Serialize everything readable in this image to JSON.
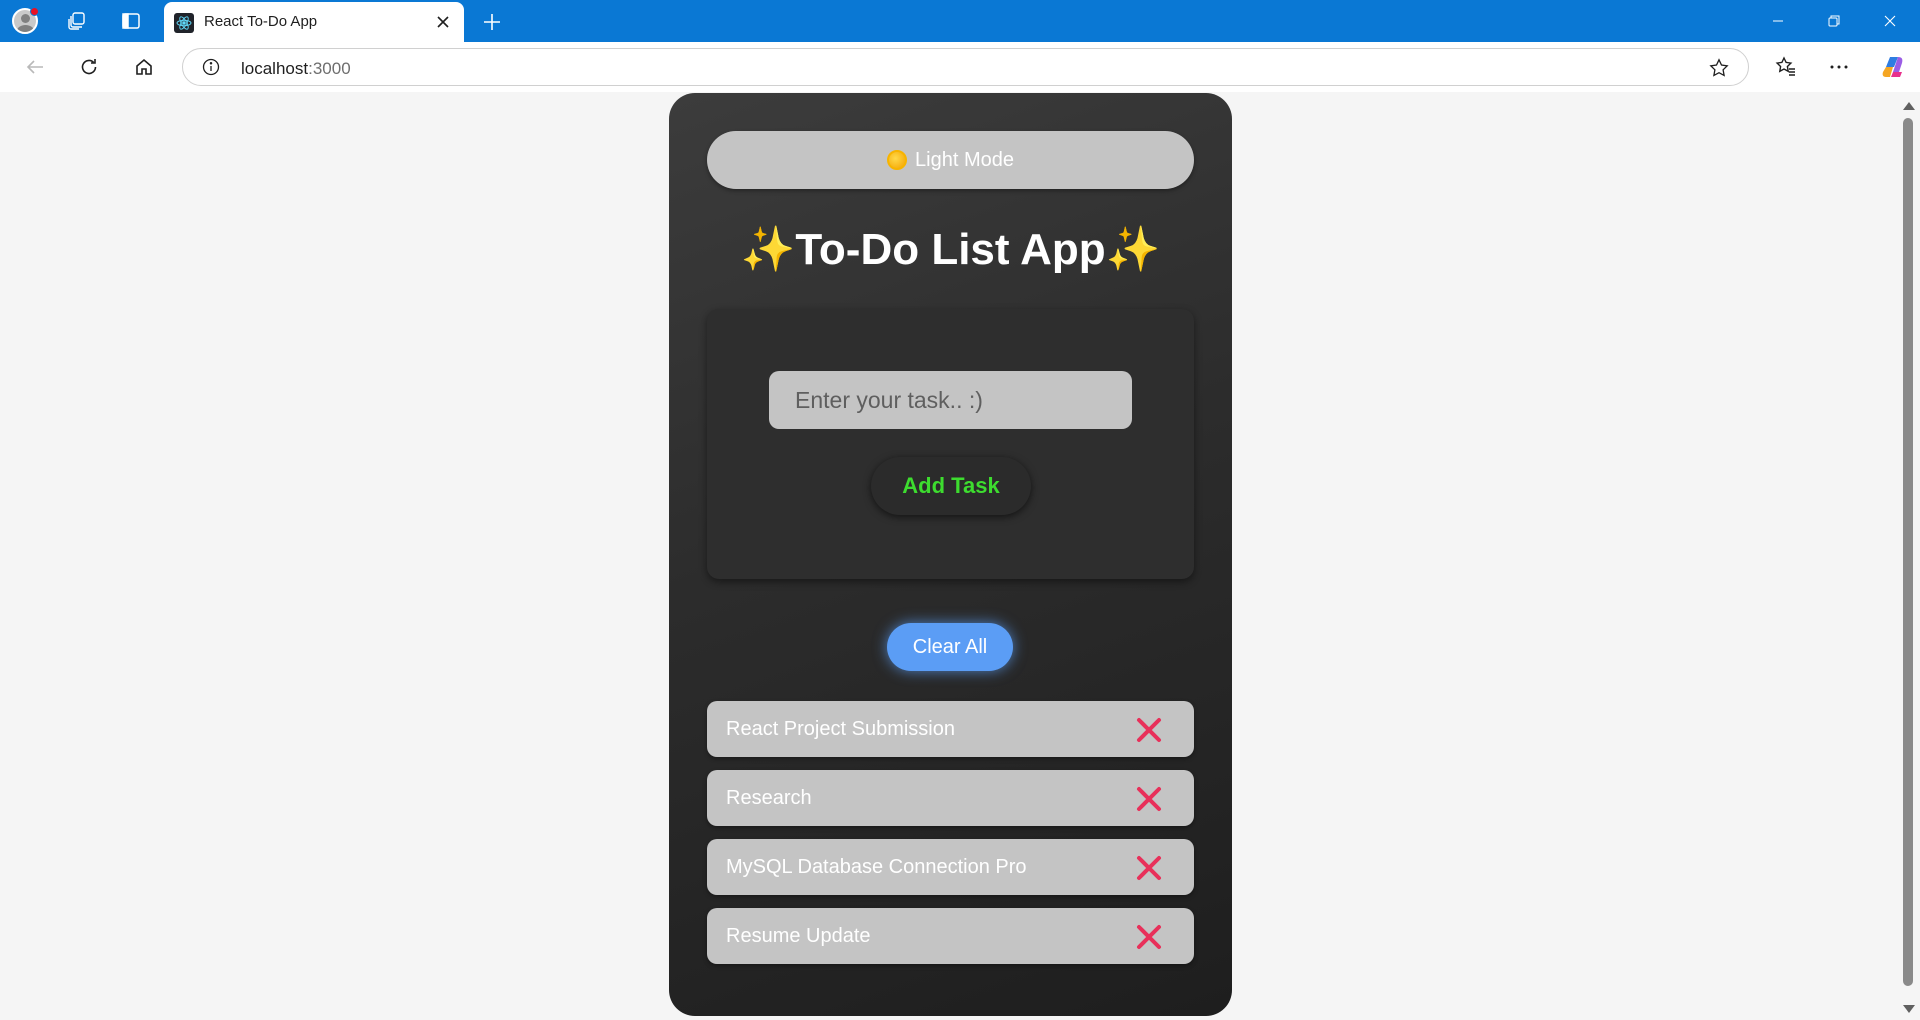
{
  "browser": {
    "tab": {
      "title": "React To-Do App"
    },
    "address": {
      "host": "localhost",
      "port": ":3000"
    }
  },
  "app": {
    "mode_toggle": {
      "label": "Light Mode",
      "icon": "sun-icon"
    },
    "title": {
      "sparkle_left": "✨",
      "text": "To-Do List App",
      "sparkle_right": "✨"
    },
    "task_input": {
      "placeholder": "Enter your task.. :)",
      "value": ""
    },
    "add_button": {
      "label": "Add Task"
    },
    "clear_button": {
      "label": "Clear All"
    },
    "tasks": [
      {
        "text": "React Project Submission"
      },
      {
        "text": "Research"
      },
      {
        "text": "MySQL Database Connection Pro"
      },
      {
        "text": "Resume Update"
      }
    ],
    "delete_icon": "close-x-icon"
  },
  "colors": {
    "browser_accent": "#0a78d4",
    "page_background": "#f5f5f5",
    "card_background": "#2c2c2c",
    "add_task_text": "#3ddc2f",
    "clear_all_button": "#5b9df5",
    "delete_icon": "#e8305a",
    "sparkle": "#f5c518"
  }
}
